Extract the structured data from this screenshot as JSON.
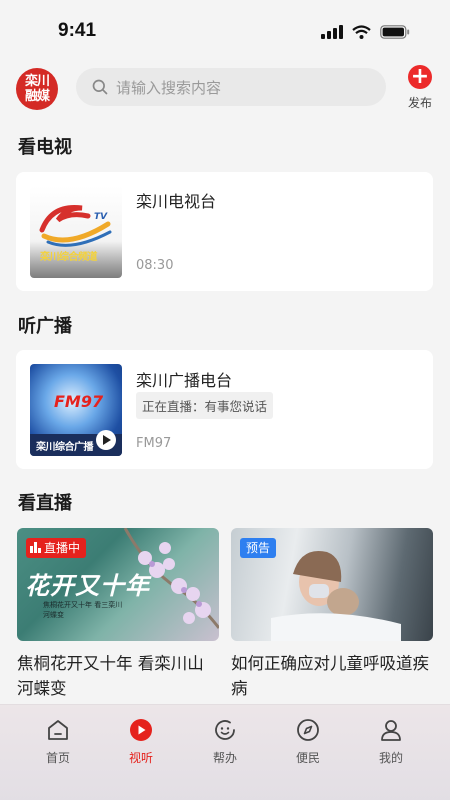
{
  "status_bar": {
    "time": "9:41"
  },
  "header": {
    "logo_line1": "栾川",
    "logo_line2": "融媒",
    "search_placeholder": "请输入搜索内容",
    "publish_label": "发布"
  },
  "tv": {
    "title": "看电视",
    "card": {
      "name": "栾川电视台",
      "time": "08:30",
      "thumb_caption": "栾川综合频道",
      "thumb_tag": "TV"
    }
  },
  "radio": {
    "title": "听广播",
    "card": {
      "name": "栾川广播电台",
      "live_status": "正在直播：有事您说话",
      "frequency": "FM97",
      "thumb_caption": "栾川综合广播",
      "thumb_tag": "FM97"
    }
  },
  "live": {
    "title": "看直播",
    "items": [
      {
        "badge": "直播中",
        "caption": "焦桐花开又十年 看栾川山河蝶变",
        "art_title": "花开又十年",
        "art_sub": "焦桐花开又十年 看三栾川河蝶变"
      },
      {
        "badge": "预告",
        "caption": "如何正确应对儿童呼吸道疾病"
      }
    ]
  },
  "tabbar": {
    "tabs": [
      {
        "label": "首页",
        "icon": "home-icon"
      },
      {
        "label": "视听",
        "icon": "play-circle-icon",
        "active": true
      },
      {
        "label": "帮办",
        "icon": "help-icon"
      },
      {
        "label": "便民",
        "icon": "compass-icon"
      },
      {
        "label": "我的",
        "icon": "profile-icon"
      }
    ]
  },
  "colors": {
    "accent": "#e5221d",
    "preview_badge": "#2e7ff0",
    "background": "#f4f4f4"
  }
}
